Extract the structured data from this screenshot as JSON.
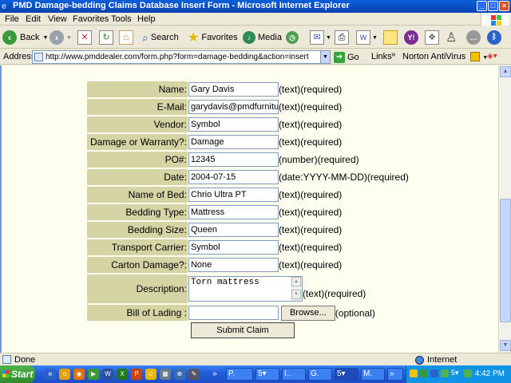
{
  "window": {
    "title": "PMD Damage-bedding Claims Database Insert Form - Microsoft Internet Explorer",
    "minimize": "_",
    "maximize": "□",
    "close": "×"
  },
  "menu": {
    "items": [
      "File",
      "Edit",
      "View",
      "Favorites",
      "Tools",
      "Help"
    ]
  },
  "toolbar": {
    "back_label": "Back",
    "search_label": "Search",
    "favorites_label": "Favorites",
    "media_label": "Media"
  },
  "address": {
    "label": "Address",
    "url": "http://www.pmddealer.com/form.php?form=damage-bedding&action=insert",
    "go_label": "Go",
    "links_label": "Links",
    "norton_label": "Norton AntiVirus"
  },
  "form": {
    "fields": [
      {
        "label": "Name:",
        "value": "Gary Davis",
        "hint": "(text)(required)"
      },
      {
        "label": "E-Mail:",
        "value": "garydavis@pmdfurnitur",
        "hint": "(text)(required)"
      },
      {
        "label": "Vendor:",
        "value": "Symbol",
        "hint": "(text)(required)"
      },
      {
        "label": "Damage or Warranty?:",
        "value": "Damage",
        "hint": "(text)(required)"
      },
      {
        "label": "PO#:",
        "value": "12345",
        "hint": "(number)(required)"
      },
      {
        "label": "Date:",
        "value": "2004-07-15",
        "hint": "(date:YYYY-MM-DD)(required)"
      },
      {
        "label": "Name of Bed:",
        "value": "Chrio Ultra PT",
        "hint": "(text)(required)"
      },
      {
        "label": "Bedding Type:",
        "value": "Mattress",
        "hint": "(text)(required)"
      },
      {
        "label": "Bedding Size:",
        "value": "Queen",
        "hint": "(text)(required)"
      },
      {
        "label": "Transport Carrier:",
        "value": "Symbol",
        "hint": "(text)(required)"
      },
      {
        "label": "Carton Damage?:",
        "value": "None",
        "hint": "(text)(required)"
      }
    ],
    "description": {
      "label": "Description:",
      "value": "Torn mattress",
      "hint": "(text)(required)"
    },
    "bill_of_lading": {
      "label": "Bill of Lading :",
      "browse_label": "Browse...",
      "hint": "(optional)"
    },
    "submit_label": "Submit Claim"
  },
  "status": {
    "text": "Done",
    "zone": "Internet"
  },
  "taskbar": {
    "start_label": "Start",
    "tasks": [
      "P.",
      "5▾",
      "I..",
      "G.",
      "5▾",
      "M.",
      "»"
    ],
    "tray_badge": "5▾",
    "clock": "4:42 PM"
  }
}
